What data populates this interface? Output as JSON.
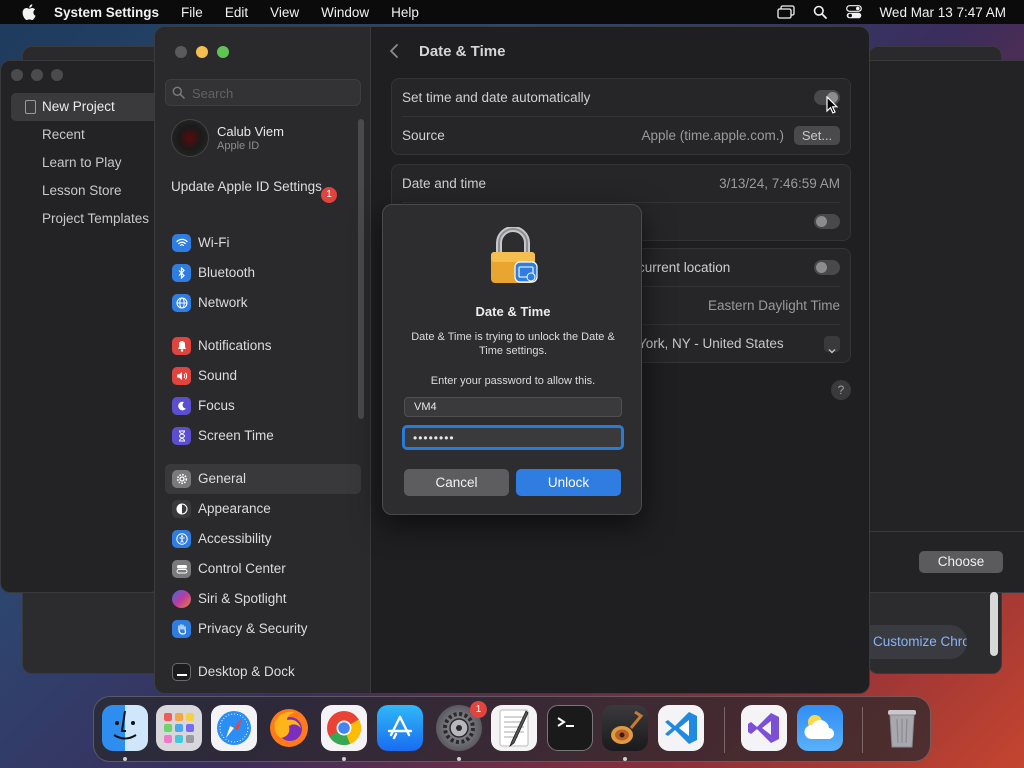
{
  "menubar": {
    "app_name": "System Settings",
    "menus": [
      "File",
      "Edit",
      "View",
      "Window",
      "Help"
    ],
    "clock": "Wed Mar 13  7:47 AM"
  },
  "bg_left_window": {
    "items": [
      "New Project",
      "Recent",
      "Learn to Play",
      "Lesson Store",
      "Project Templates"
    ]
  },
  "bg_right_window": {
    "choose_label": "Choose",
    "chrome_text": "Customize Chrome"
  },
  "sidebar": {
    "search_placeholder": "Search",
    "account_name": "Calub Viem",
    "account_sub": "Apple ID",
    "update_label": "Update Apple ID Settings",
    "update_badge": "1",
    "group1": [
      {
        "label": "Wi-Fi",
        "icon": "wifi-icon",
        "color": "#2f7de0"
      },
      {
        "label": "Bluetooth",
        "icon": "bluetooth-icon",
        "color": "#2f7de0"
      },
      {
        "label": "Network",
        "icon": "globe-icon",
        "color": "#2f7de0"
      }
    ],
    "group2": [
      {
        "label": "Notifications",
        "icon": "bell-icon",
        "color": "#e0443f"
      },
      {
        "label": "Sound",
        "icon": "speaker-icon",
        "color": "#e0443f"
      },
      {
        "label": "Focus",
        "icon": "moon-icon",
        "color": "#5b4fd0"
      },
      {
        "label": "Screen Time",
        "icon": "hourglass-icon",
        "color": "#5b4fd0"
      }
    ],
    "group3": [
      {
        "label": "General",
        "icon": "gear-icon",
        "color": "#7a7a7e"
      },
      {
        "label": "Appearance",
        "icon": "appearance-icon",
        "color": "#3a3a3c"
      },
      {
        "label": "Accessibility",
        "icon": "accessibility-icon",
        "color": "#2f7de0"
      },
      {
        "label": "Control Center",
        "icon": "control-center-icon",
        "color": "#7a7a7e"
      },
      {
        "label": "Siri & Spotlight",
        "icon": "siri-icon",
        "color": "#b0399e"
      },
      {
        "label": "Privacy & Security",
        "icon": "hand-icon",
        "color": "#2f7de0"
      }
    ],
    "group4": [
      {
        "label": "Desktop & Dock",
        "icon": "dock-icon",
        "color": "#1c1c1e"
      }
    ]
  },
  "content": {
    "title": "Date & Time",
    "auto_label": "Set time and date automatically",
    "source_label": "Source",
    "source_value": "Apple (time.apple.com.)",
    "set_button": "Set...",
    "date_time_label": "Date and time",
    "date_time_value": "3/13/24, 7:46:59 AM",
    "location_label": "current location",
    "timezone_value": "Eastern Daylight Time",
    "city_value": "York, NY - United States",
    "help": "?"
  },
  "dialog": {
    "title": "Date & Time",
    "message": "Date & Time is trying to unlock the Date & Time settings.",
    "prompt": "Enter your password to allow this.",
    "username": "VM4",
    "password_mask": "••••••••",
    "cancel": "Cancel",
    "unlock": "Unlock"
  },
  "dock": {
    "apps": [
      {
        "name": "finder-icon"
      },
      {
        "name": "launchpad-icon"
      },
      {
        "name": "safari-icon"
      },
      {
        "name": "firefox-icon"
      },
      {
        "name": "chrome-icon"
      },
      {
        "name": "app-store-icon"
      },
      {
        "name": "system-settings-icon",
        "badge": "1"
      },
      {
        "name": "textedit-icon"
      },
      {
        "name": "terminal-icon"
      },
      {
        "name": "garageband-icon"
      },
      {
        "name": "vscode-icon"
      },
      {
        "name": "visual-studio-icon"
      },
      {
        "name": "weather-icon"
      },
      {
        "name": "trash-icon"
      }
    ]
  }
}
